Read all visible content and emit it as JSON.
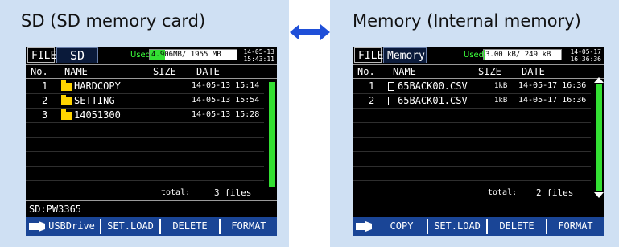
{
  "left_panel": {
    "title": "SD (SD memory card)",
    "screen": {
      "tabs": [
        {
          "label": "FILE",
          "active": false
        },
        {
          "label": "SD",
          "active": true
        }
      ],
      "used_label": "Used",
      "used_value": "4.906MB/ 1955 MB",
      "used_fraction": 0.18,
      "date": "14-05-13",
      "time": "15:43:11",
      "columns": {
        "no": "No.",
        "name": "NAME",
        "size": "SIZE",
        "date": "DATE"
      },
      "files": [
        {
          "no": "1",
          "name": "HARDCOPY",
          "icon": "folder-icon",
          "size": "",
          "date": "14-05-13 15:14"
        },
        {
          "no": "2",
          "name": "SETTING",
          "icon": "folder-icon",
          "size": "",
          "date": "14-05-13 15:54"
        },
        {
          "no": "3",
          "name": "14051300",
          "icon": "folder-icon",
          "size": "",
          "date": "14-05-13 15:28"
        }
      ],
      "total_label": "total:",
      "total_value": "3 files",
      "device": "SD:PW3365",
      "softkeys": [
        "USBDrive",
        "SET.LOAD",
        "DELETE",
        "FORMAT"
      ],
      "softkey_icon": "usb-plug-icon"
    }
  },
  "right_panel": {
    "title": "Memory (Internal memory)",
    "screen": {
      "tabs": [
        {
          "label": "FILE",
          "active": false
        },
        {
          "label": "Memory",
          "active": true
        }
      ],
      "used_label": "Used",
      "used_value": "3.00 kB/ 249 kB",
      "used_fraction": 0.01,
      "date": "14-05-17",
      "time": "16:36:36",
      "columns": {
        "no": "No.",
        "name": "NAME",
        "size": "SIZE",
        "date": "DATE"
      },
      "files": [
        {
          "no": "1",
          "name": "65BACK00.CSV",
          "icon": "document-icon",
          "size": "1kB",
          "date": "14-05-17 16:36"
        },
        {
          "no": "2",
          "name": "65BACK01.CSV",
          "icon": "document-icon",
          "size": "1kB",
          "date": "14-05-17 16:36"
        }
      ],
      "total_label": "total:",
      "total_value": "2 files",
      "softkeys": [
        "COPY",
        "SET.LOAD",
        "DELETE",
        "FORMAT"
      ],
      "softkey_icon": "usb-plug-icon"
    }
  },
  "link_arrow": "double-headed-arrow-icon",
  "colors": {
    "panel_bg": "#cfe0f3",
    "screen_bg": "#000000",
    "softkey_bar": "#1a4596",
    "accent_green": "#33e033",
    "folder_yellow": "#ffd400",
    "arrow_blue": "#1f4fd8"
  }
}
